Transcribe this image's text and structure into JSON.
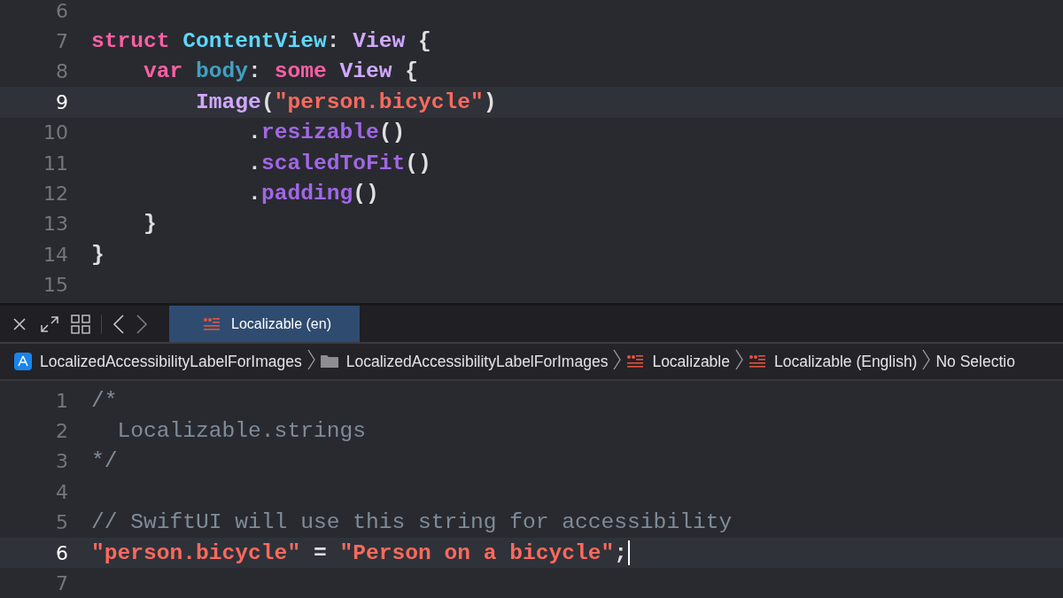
{
  "top_editor": {
    "lines": [
      {
        "number": "6",
        "current": false,
        "cursor": false
      },
      {
        "number": "7",
        "current": false,
        "cursor": false,
        "tokens": [
          {
            "kind": "keyword",
            "text": "struct"
          },
          {
            "kind": "declaration",
            "text": " ContentView"
          },
          {
            "kind": "plain",
            "text": ": "
          },
          {
            "kind": "type",
            "text": "View"
          },
          {
            "kind": "plain",
            "text": " {"
          }
        ]
      },
      {
        "number": "8",
        "current": false,
        "cursor": false,
        "tokens": [
          {
            "kind": "keyword",
            "text": "    var"
          },
          {
            "kind": "property",
            "text": " body"
          },
          {
            "kind": "plain",
            "text": ": "
          },
          {
            "kind": "keyword",
            "text": "some"
          },
          {
            "kind": "type",
            "text": " View"
          },
          {
            "kind": "plain",
            "text": " {"
          }
        ]
      },
      {
        "number": "9",
        "current": true,
        "cursor": false,
        "tokens": [
          {
            "kind": "type",
            "text": "        Image"
          },
          {
            "kind": "plain",
            "text": "("
          },
          {
            "kind": "string",
            "text": "\"person.bicycle\""
          },
          {
            "kind": "plain",
            "text": ")"
          }
        ]
      },
      {
        "number": "10",
        "current": false,
        "cursor": false,
        "tokens": [
          {
            "kind": "plain",
            "text": "            ."
          },
          {
            "kind": "method",
            "text": "resizable"
          },
          {
            "kind": "plain",
            "text": "()"
          }
        ]
      },
      {
        "number": "11",
        "current": false,
        "cursor": false,
        "tokens": [
          {
            "kind": "plain",
            "text": "            ."
          },
          {
            "kind": "method",
            "text": "scaledToFit"
          },
          {
            "kind": "plain",
            "text": "()"
          }
        ]
      },
      {
        "number": "12",
        "current": false,
        "cursor": false,
        "tokens": [
          {
            "kind": "plain",
            "text": "            ."
          },
          {
            "kind": "method",
            "text": "padding"
          },
          {
            "kind": "plain",
            "text": "()"
          }
        ]
      },
      {
        "number": "13",
        "current": false,
        "cursor": false,
        "tokens": [
          {
            "kind": "plain",
            "text": "    }"
          }
        ]
      },
      {
        "number": "14",
        "current": false,
        "cursor": false,
        "tokens": [
          {
            "kind": "plain",
            "text": "}"
          }
        ]
      },
      {
        "number": "15",
        "current": false,
        "cursor": false
      }
    ]
  },
  "toolbar": {
    "tabs": [
      {
        "label": "Localizable (en)",
        "selected": true
      }
    ],
    "forward_enabled": false
  },
  "path_bar": [
    {
      "kind": "app",
      "label": "LocalizedAccessibilityLabelForImages"
    },
    {
      "kind": "folder",
      "label": "LocalizedAccessibilityLabelForImages"
    },
    {
      "kind": "strings",
      "label": "Localizable"
    },
    {
      "kind": "strings",
      "label": "Localizable (English)"
    },
    {
      "kind": "none",
      "label": "No Selectio"
    }
  ],
  "bottom_editor": {
    "lines": [
      {
        "number": "1",
        "current": false,
        "cursor": false,
        "tokens": [
          {
            "kind": "comment",
            "text": "/*"
          }
        ]
      },
      {
        "number": "2",
        "current": false,
        "cursor": false,
        "tokens": [
          {
            "kind": "comment",
            "text": "  Localizable.strings"
          }
        ]
      },
      {
        "number": "3",
        "current": false,
        "cursor": false,
        "tokens": [
          {
            "kind": "comment",
            "text": "*/"
          }
        ]
      },
      {
        "number": "4",
        "current": false,
        "cursor": false
      },
      {
        "number": "5",
        "current": false,
        "cursor": false,
        "tokens": [
          {
            "kind": "comment",
            "text": "// SwiftUI will use this string for accessibility"
          }
        ]
      },
      {
        "number": "6",
        "current": true,
        "cursor": true,
        "tokens": [
          {
            "kind": "string",
            "text": "\"person.bicycle\""
          },
          {
            "kind": "plain",
            "text": " = "
          },
          {
            "kind": "string",
            "text": "\"Person on a bicycle\""
          },
          {
            "kind": "plain",
            "text": ";"
          }
        ]
      },
      {
        "number": "7",
        "current": false,
        "cursor": false
      }
    ]
  }
}
